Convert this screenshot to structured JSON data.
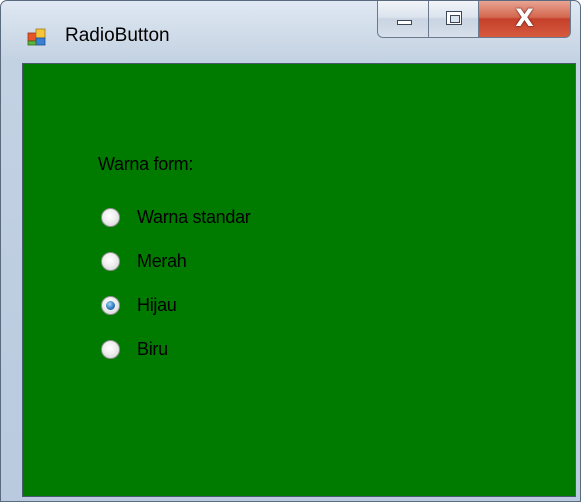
{
  "window": {
    "title": "RadioButton",
    "icon": "windows-form-icon",
    "caption_buttons": {
      "minimize": "minimize-icon",
      "maximize": "maximize-icon",
      "close": "close-icon",
      "close_glyph": "X"
    }
  },
  "form": {
    "background_color": "#007b00",
    "group_label": "Warna form:",
    "radios": [
      {
        "label": "Warna standar",
        "checked": false
      },
      {
        "label": "Merah",
        "checked": false
      },
      {
        "label": "Hijau",
        "checked": true
      },
      {
        "label": "Biru",
        "checked": false
      }
    ]
  }
}
